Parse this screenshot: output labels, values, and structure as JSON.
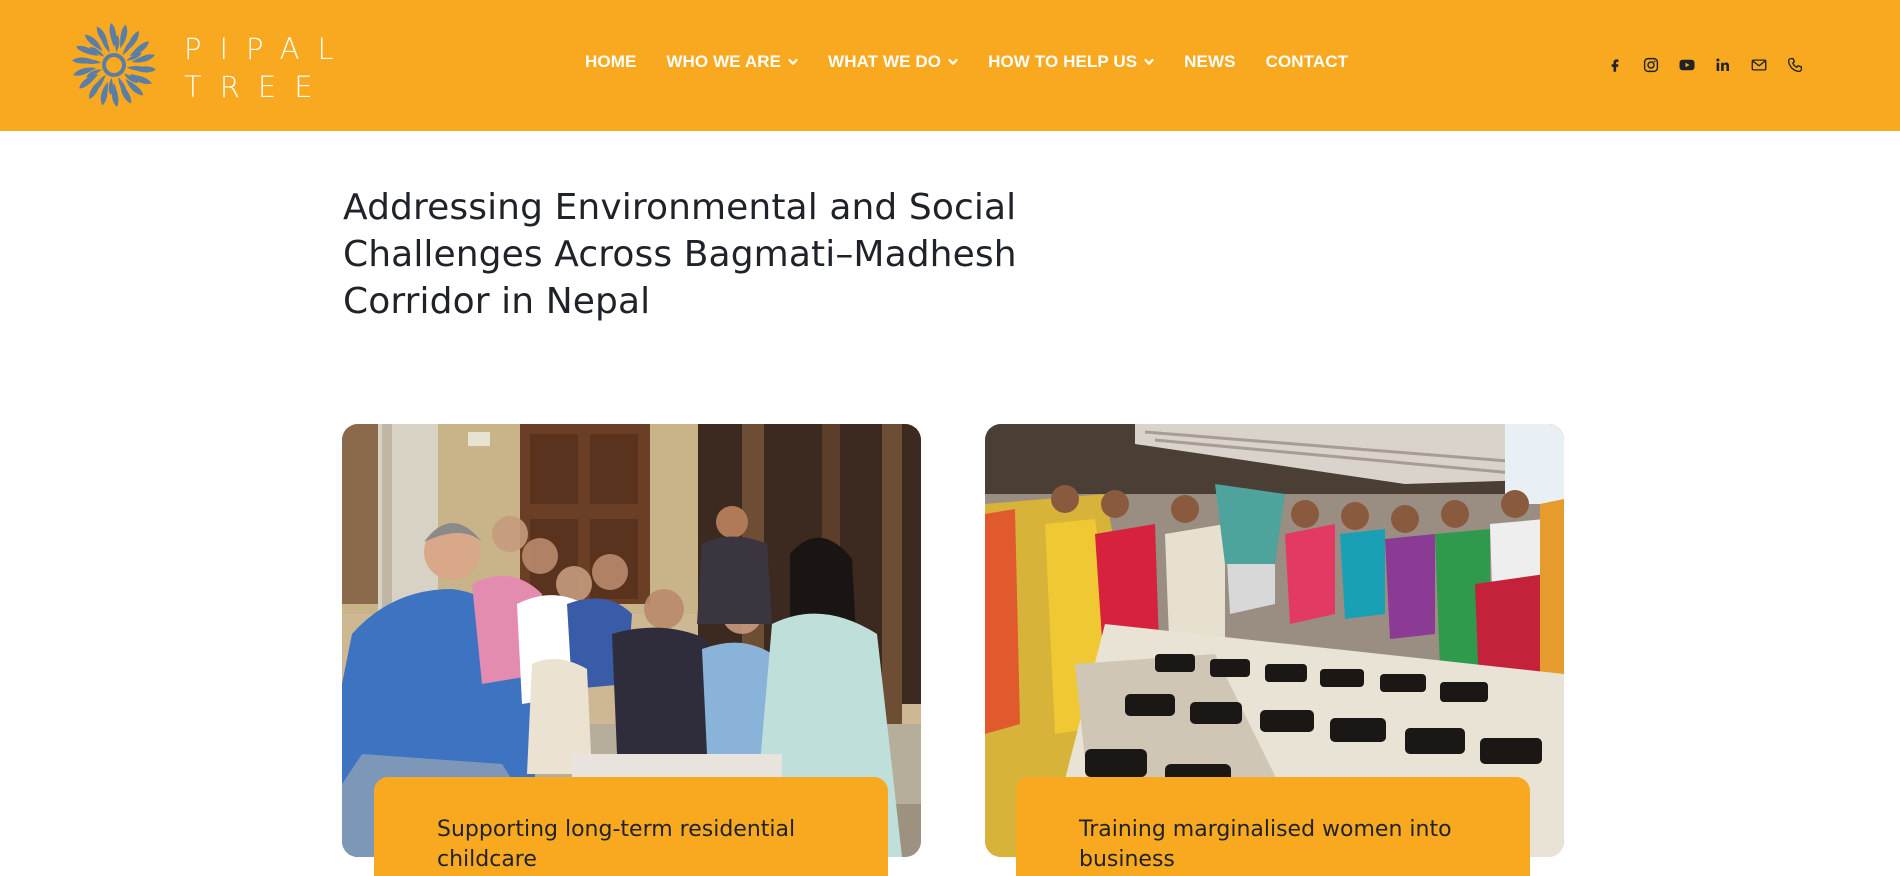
{
  "brand": {
    "line1": "PIPAL",
    "line2": "TREE",
    "color": "#f9a91f",
    "logo_icon": "sunburst-flower-icon"
  },
  "nav": {
    "items": [
      {
        "label": "HOME",
        "dropdown": false
      },
      {
        "label": "WHO WE ARE",
        "dropdown": true
      },
      {
        "label": "WHAT WE DO",
        "dropdown": true
      },
      {
        "label": "HOW TO HELP US",
        "dropdown": true
      },
      {
        "label": "NEWS",
        "dropdown": false
      },
      {
        "label": "CONTACT",
        "dropdown": false
      }
    ]
  },
  "social": [
    "facebook-icon",
    "instagram-icon",
    "youtube-icon",
    "linkedin-icon",
    "email-icon",
    "phone-icon"
  ],
  "main": {
    "title": "Addressing Environmental and Social Challenges Across Bagmati–Madhesh Corridor in Nepal",
    "cards": [
      {
        "caption": "Supporting long-term residential childcare",
        "image": "group-photo-children-and-adults"
      },
      {
        "caption": "Training marginalised women into business",
        "image": "women-sewing-machines-training"
      }
    ]
  }
}
